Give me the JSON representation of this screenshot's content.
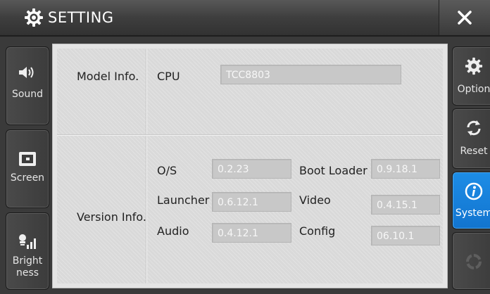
{
  "header": {
    "title": "SETTING"
  },
  "left_tabs": [
    {
      "label": "Sound",
      "icon": "speaker-icon"
    },
    {
      "label": "Screen",
      "icon": "screen-icon"
    },
    {
      "label": "Bright\nness",
      "label_lines": [
        "Bright",
        "ness"
      ],
      "icon": "brightness-icon"
    }
  ],
  "right_tabs": [
    {
      "label": "Option",
      "icon": "gear-icon"
    },
    {
      "label": "Reset",
      "icon": "refresh-icon"
    },
    {
      "label": "System",
      "icon": "info-icon",
      "active": true
    },
    {
      "label": "",
      "icon": "spinner-icon"
    }
  ],
  "model": {
    "section_label": "Model Info.",
    "cpu_label": "CPU",
    "cpu_value": "TCC8803"
  },
  "version": {
    "section_label": "Version Info.",
    "os_label": "O/S",
    "os_value": "0.2.23",
    "bootloader_label": "Boot Loader",
    "bootloader_value": "0.9.18.1",
    "launcher_label": "Launcher",
    "launcher_value": "0.6.12.1",
    "video_label": "Video",
    "video_value": "0.4.15.1",
    "audio_label": "Audio",
    "audio_value": "0.4.12.1",
    "config_label": "Config",
    "config_value": "06.10.1"
  },
  "colors": {
    "accent": "#1a84e0",
    "background": "#3a3a3a",
    "panel": "#d9d9d9"
  }
}
